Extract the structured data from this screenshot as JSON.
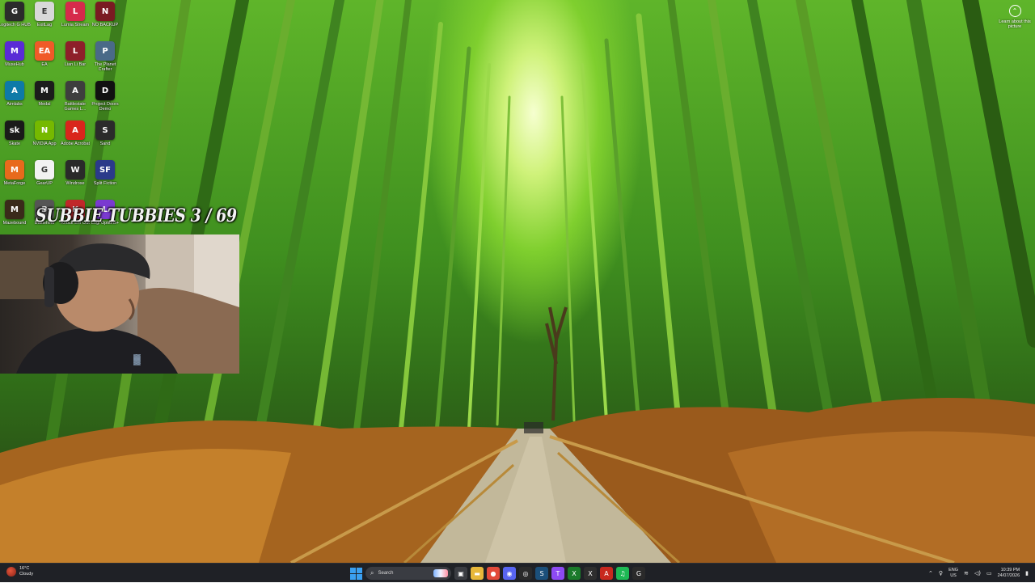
{
  "overlay": {
    "title": "SUBBIE TUBBIES 3 / 69"
  },
  "desktop": {
    "icons": [
      {
        "label": "Logitech G HUB",
        "icon": "logitech-g-icon",
        "color": "#2b2b2b",
        "glyph": "G"
      },
      {
        "label": "ExitLag",
        "icon": "exitlag-icon",
        "color": "#d8d8d8",
        "glyph": "E"
      },
      {
        "label": "Lumia Stream",
        "icon": "lumia-stream-icon",
        "color": "#d62b4b",
        "glyph": "L"
      },
      {
        "label": "NO BACKUP",
        "icon": "folder-backup-icon",
        "color": "#7a1b22",
        "glyph": "N"
      },
      {
        "label": "MuseHub",
        "icon": "musehub-icon",
        "color": "#5a2bd6",
        "glyph": "M"
      },
      {
        "label": "EA",
        "icon": "ea-icon",
        "color": "#f05a28",
        "glyph": "EA"
      },
      {
        "label": "Lian Li Bar",
        "icon": "lian-li-icon",
        "color": "#8e1f2a",
        "glyph": "L"
      },
      {
        "label": "The Planet Crafter",
        "icon": "planet-crafter-icon",
        "color": "#4a6a88",
        "glyph": "P"
      },
      {
        "label": "Aimlabs",
        "icon": "aimlabs-icon",
        "color": "#0e7aa8",
        "glyph": "A"
      },
      {
        "label": "Medal",
        "icon": "medal-icon",
        "color": "#1c1c1c",
        "glyph": "M"
      },
      {
        "label": "Battlestate Games L...",
        "icon": "battlestate-icon",
        "color": "#3e3e3e",
        "glyph": "A"
      },
      {
        "label": "Project Doors Demo",
        "icon": "project-doors-icon",
        "color": "#111111",
        "glyph": "D"
      },
      {
        "label": "Skate",
        "icon": "skate-icon",
        "color": "#1a1a1a",
        "glyph": "sk"
      },
      {
        "label": "NVIDIA App",
        "icon": "nvidia-icon",
        "color": "#76b900",
        "glyph": "N"
      },
      {
        "label": "Adobe Acrobat",
        "icon": "acrobat-icon",
        "color": "#d9261c",
        "glyph": "A"
      },
      {
        "label": "Sand",
        "icon": "sand-icon",
        "color": "#2b2b2b",
        "glyph": "S"
      },
      {
        "label": "MetaForge",
        "icon": "metaforge-icon",
        "color": "#e86a1c",
        "glyph": "M"
      },
      {
        "label": "GearUP",
        "icon": "gearup-icon",
        "color": "#f2f2f2",
        "glyph": "G"
      },
      {
        "label": "Windrose",
        "icon": "windrose-icon",
        "color": "#2a2a2a",
        "glyph": "W"
      },
      {
        "label": "Split Fiction",
        "icon": "split-fiction-icon",
        "color": "#2b3a8a",
        "glyph": "SF"
      },
      {
        "label": "Mazebound",
        "icon": "mazebound-icon",
        "color": "#3a2a1a",
        "glyph": "M"
      },
      {
        "label": "Battlefield",
        "icon": "battlefield-icon",
        "color": "#555555",
        "glyph": "B"
      },
      {
        "label": "Knock Em Out",
        "icon": "knock-em-out-icon",
        "color": "#c0282a",
        "glyph": "K"
      },
      {
        "label": "Logi Options+",
        "icon": "logi-options-icon",
        "color": "#7a3ad0",
        "glyph": "L"
      }
    ]
  },
  "learn_picture": {
    "label": "Learn about this picture"
  },
  "taskbar": {
    "weather": {
      "temp": "16°C",
      "condition": "Cloudy"
    },
    "search_placeholder": "Search",
    "apps": [
      {
        "icon": "task-view-icon",
        "color": "#3a3c42",
        "glyph": "▣"
      },
      {
        "icon": "file-explorer-icon",
        "color": "#e8b83a",
        "glyph": "▬"
      },
      {
        "icon": "chrome-icon",
        "color": "#e24a3a",
        "glyph": "●"
      },
      {
        "icon": "discord-icon",
        "color": "#5865f2",
        "glyph": "◉"
      },
      {
        "icon": "obs-icon",
        "color": "#2a2a2a",
        "glyph": "◎"
      },
      {
        "icon": "steam-icon",
        "color": "#1b4f7a",
        "glyph": "S"
      },
      {
        "icon": "twitch-icon",
        "color": "#8d4af3",
        "glyph": "T"
      },
      {
        "icon": "xbox-icon",
        "color": "#1a7a2a",
        "glyph": "X"
      },
      {
        "icon": "xbox-app-icon",
        "color": "#2e2e2e",
        "glyph": "X"
      },
      {
        "icon": "acrobat-taskbar-icon",
        "color": "#c8281e",
        "glyph": "A"
      },
      {
        "icon": "spotify-icon",
        "color": "#1db954",
        "glyph": "♫"
      },
      {
        "icon": "logitech-ghub-taskbar-icon",
        "color": "#2a2a2a",
        "glyph": "G"
      }
    ],
    "tray": {
      "lang_top": "ENG",
      "lang_bottom": "US",
      "time": "10:39 PM",
      "date": "24/07/2026"
    }
  }
}
